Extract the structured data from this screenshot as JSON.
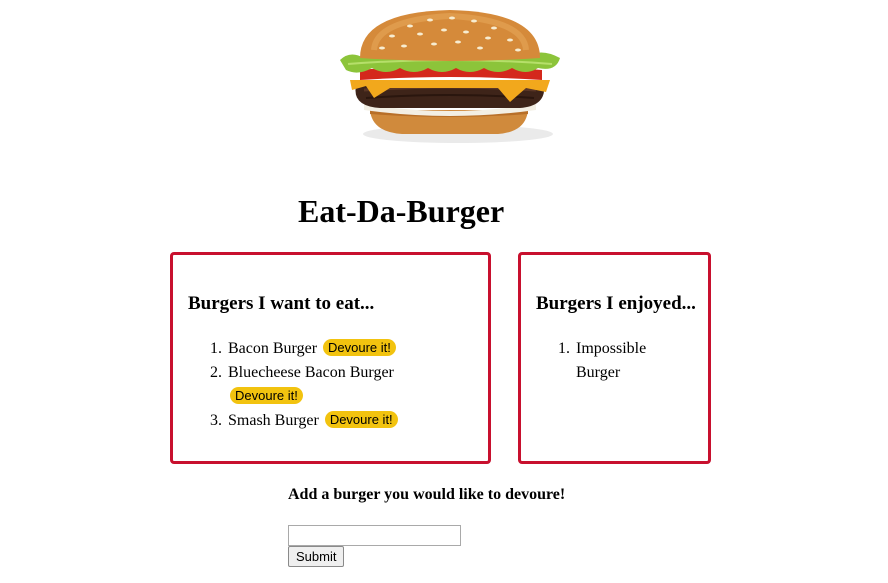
{
  "header": {
    "title": "Eat-Da-Burger"
  },
  "want_to_eat": {
    "heading": "Burgers I want to eat...",
    "items": [
      {
        "number": "1.",
        "name": "Bacon Burger",
        "button_label": "Devoure it!"
      },
      {
        "number": "2.",
        "name": "Bluecheese Bacon Burger",
        "button_label": "Devoure it!"
      },
      {
        "number": "3.",
        "name": "Smash Burger",
        "button_label": "Devoure it!"
      }
    ]
  },
  "enjoyed": {
    "heading": "Burgers I enjoyed...",
    "items": [
      {
        "number": "1.",
        "name": "Impossible Burger"
      }
    ]
  },
  "form": {
    "label": "Add a burger you would like to devoure!",
    "input_value": "",
    "submit_label": "Submit"
  },
  "colors": {
    "card_border": "#c8102e",
    "button_bg": "#f2c30f"
  },
  "icons": {
    "hero": "hamburger-image"
  }
}
